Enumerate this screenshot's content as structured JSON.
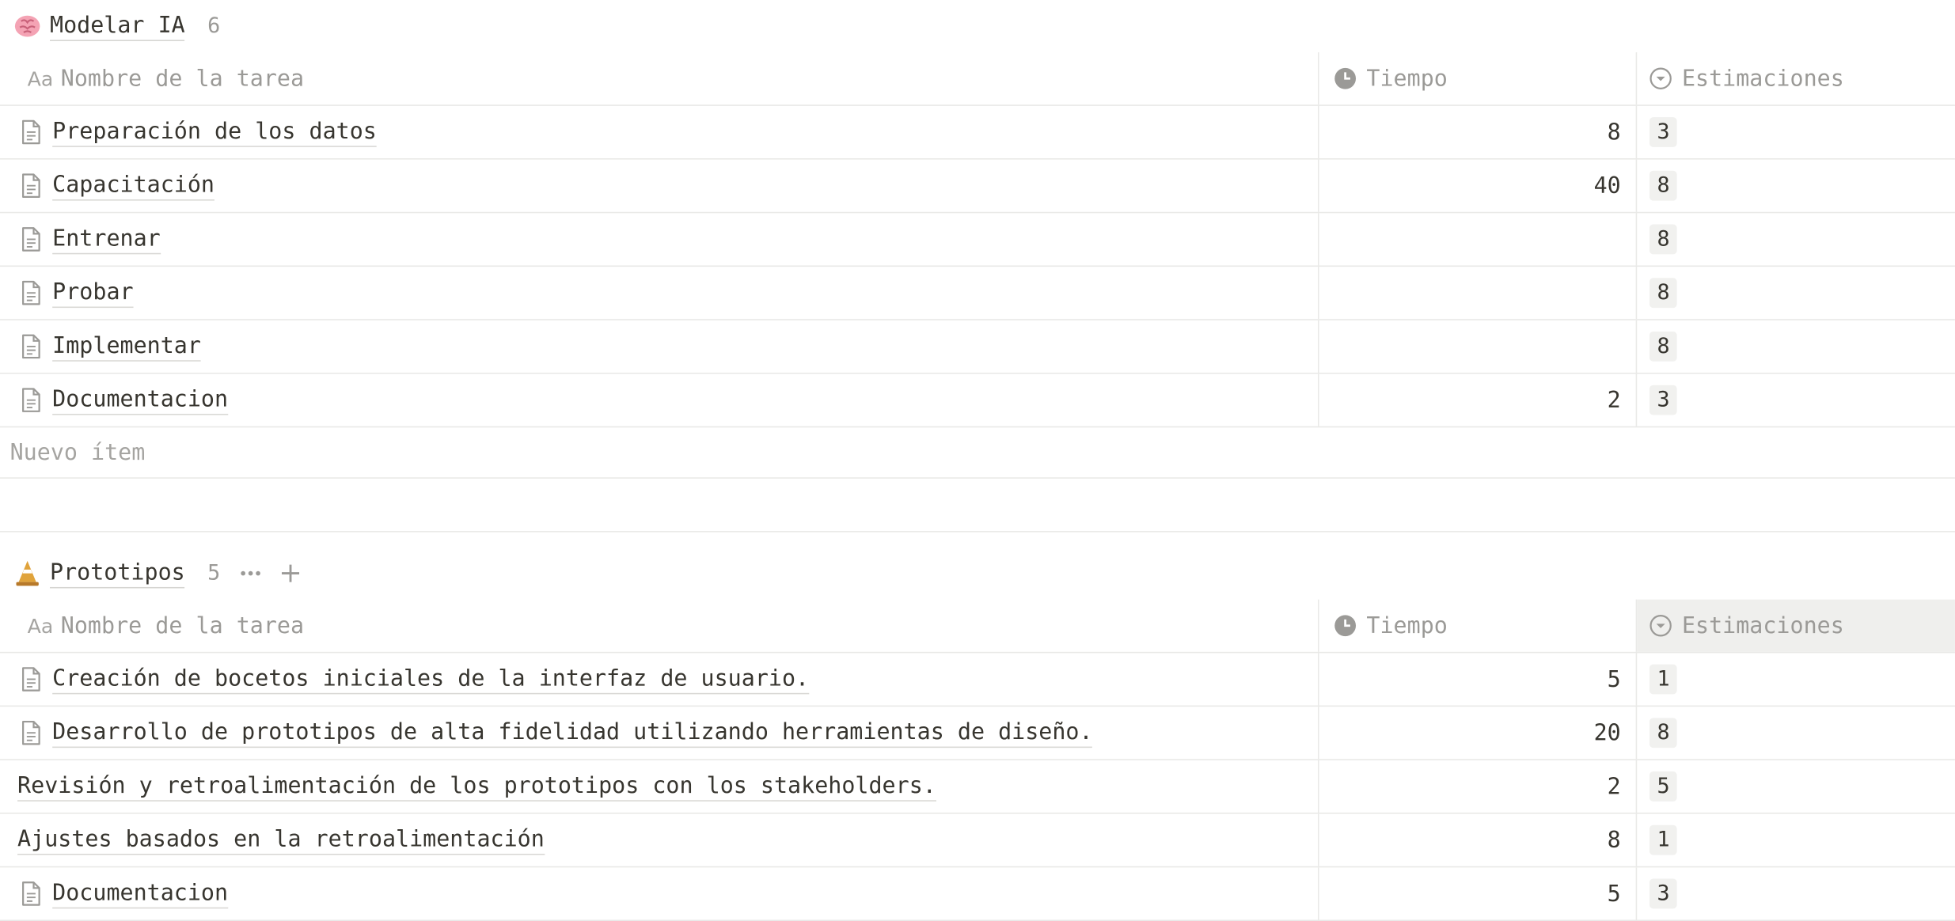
{
  "groups": [
    {
      "emoji": "brain-emoji",
      "title": "Modelar IA",
      "count": "6",
      "columns": {
        "name": "Nombre de la tarea",
        "time": "Tiempo",
        "estimate": "Estimaciones"
      },
      "columns_name_prefix": "Aa",
      "rows": [
        {
          "title": "Preparación de los datos",
          "time": "8",
          "estimate": "3",
          "icon": "document-icon"
        },
        {
          "title": "Capacitación",
          "time": "40",
          "estimate": "8",
          "icon": "document-icon"
        },
        {
          "title": "Entrenar",
          "time": "",
          "estimate": "8",
          "icon": "document-icon"
        },
        {
          "title": "Probar",
          "time": "",
          "estimate": "8",
          "icon": "document-icon"
        },
        {
          "title": "Implementar",
          "time": "",
          "estimate": "8",
          "icon": "document-icon"
        },
        {
          "title": "Documentacion",
          "time": "2",
          "estimate": "3",
          "icon": "document-icon"
        }
      ],
      "new_item_label": "Nuevo ítem"
    },
    {
      "emoji": "traffic-cone-emoji",
      "title": "Prototipos",
      "count": "5",
      "columns": {
        "name": "Nombre de la tarea",
        "time": "Tiempo",
        "estimate": "Estimaciones"
      },
      "columns_name_prefix": "Aa",
      "rows": [
        {
          "title": "Creación de bocetos iniciales de la interfaz de usuario.",
          "time": "5",
          "estimate": "1",
          "icon": "document-icon"
        },
        {
          "title": "Desarrollo de prototipos de alta fidelidad utilizando herramientas de diseño.",
          "time": "20",
          "estimate": "8",
          "icon": "document-icon"
        },
        {
          "title": "Revisión y retroalimentación de los prototipos con los stakeholders.",
          "time": "2",
          "estimate": "5",
          "icon": ""
        },
        {
          "title": "Ajustes basados en la retroalimentación",
          "time": "8",
          "estimate": "1",
          "icon": ""
        },
        {
          "title": "Documentacion",
          "time": "5",
          "estimate": "3",
          "icon": "document-icon"
        }
      ]
    }
  ],
  "colors": {
    "text": "#37352f",
    "muted": "#9b9a97",
    "border": "#e9e9e7",
    "badge_bg": "#f1f1ef"
  }
}
